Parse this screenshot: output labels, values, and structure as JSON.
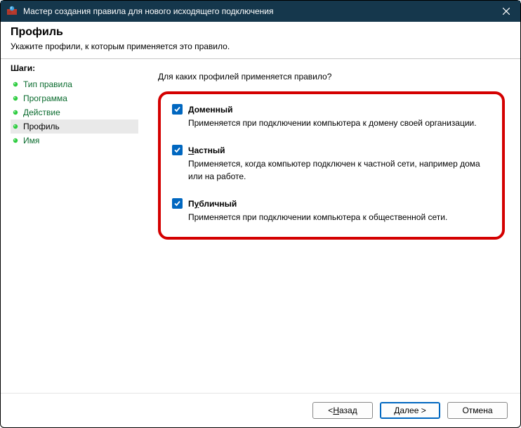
{
  "titlebar": {
    "title": "Мастер создания правила для нового исходящего подключения"
  },
  "header": {
    "title": "Профиль",
    "subtitle": "Укажите профили, к которым применяется это правило."
  },
  "sidebar": {
    "heading": "Шаги:",
    "steps": [
      {
        "label": "Тип правила",
        "current": false
      },
      {
        "label": "Программа",
        "current": false
      },
      {
        "label": "Действие",
        "current": false
      },
      {
        "label": "Профиль",
        "current": true
      },
      {
        "label": "Имя",
        "current": false
      }
    ]
  },
  "main": {
    "prompt": "Для каких профилей применяется правило?",
    "profiles": [
      {
        "checked": true,
        "label_pre": "",
        "mnemonic": "Д",
        "label_post": "оменный",
        "description": "Применяется при подключении компьютера к домену своей организации."
      },
      {
        "checked": true,
        "label_pre": "",
        "mnemonic": "Ч",
        "label_post": "астный",
        "description": "Применяется, когда компьютер подключен к частной сети, например дома или на работе."
      },
      {
        "checked": true,
        "label_pre": "П",
        "mnemonic": "у",
        "label_post": "бличный",
        "description": "Применяется при подключении компьютера к общественной сети."
      }
    ]
  },
  "footer": {
    "back": {
      "pre": "< ",
      "mn": "Н",
      "post": "азад"
    },
    "next": {
      "pre": "",
      "mn": "Д",
      "post": "алее >"
    },
    "cancel": {
      "label": "Отмена"
    }
  }
}
